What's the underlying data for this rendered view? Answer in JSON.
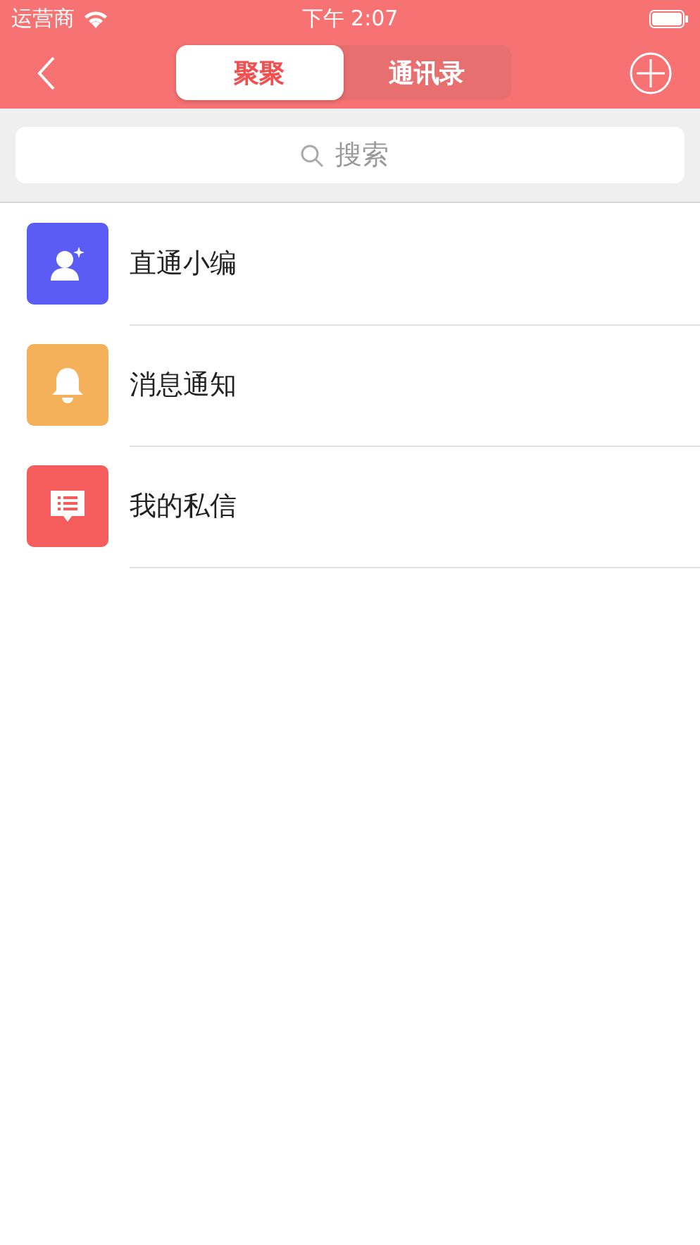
{
  "status_bar": {
    "carrier": "运营商",
    "time": "下午 2:07"
  },
  "tabs": [
    {
      "label": "聚聚",
      "selected": true
    },
    {
      "label": "通讯录",
      "selected": false
    }
  ],
  "search": {
    "placeholder": "搜索"
  },
  "items": [
    {
      "kind": "person",
      "label": "直通小编",
      "color": "#5b5bf5"
    },
    {
      "kind": "bell",
      "label": "消息通知",
      "color": "#f5b05a"
    },
    {
      "kind": "message",
      "label": "我的私信",
      "color": "#f55d5d"
    }
  ]
}
